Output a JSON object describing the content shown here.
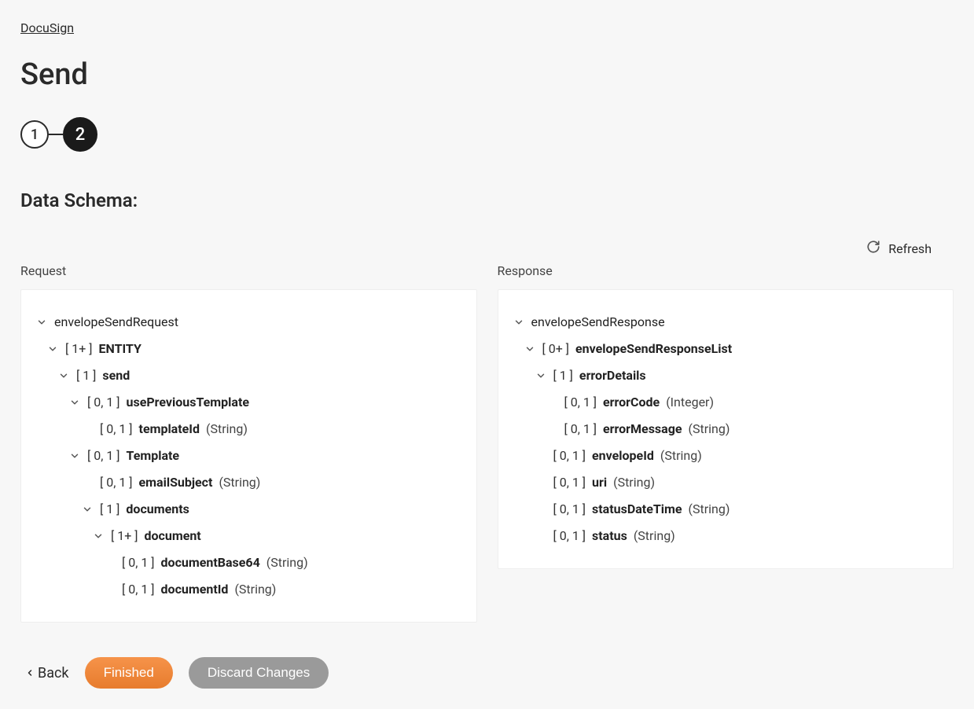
{
  "breadcrumb": "DocuSign",
  "page_title": "Send",
  "stepper": {
    "step1": "1",
    "step2": "2"
  },
  "section_title": "Data Schema:",
  "refresh_label": "Refresh",
  "request_label": "Request",
  "response_label": "Response",
  "request_tree": [
    {
      "indent": 0,
      "expandable": true,
      "cardinality": "",
      "name": "envelopeSendRequest",
      "bold": false,
      "type": ""
    },
    {
      "indent": 1,
      "expandable": true,
      "cardinality": "[ 1+ ]",
      "name": "ENTITY",
      "bold": true,
      "type": ""
    },
    {
      "indent": 2,
      "expandable": true,
      "cardinality": "[ 1 ]",
      "name": "send",
      "bold": true,
      "type": ""
    },
    {
      "indent": 3,
      "expandable": true,
      "cardinality": "[ 0, 1 ]",
      "name": "usePreviousTemplate",
      "bold": true,
      "type": ""
    },
    {
      "indent": 4,
      "expandable": false,
      "cardinality": "[ 0, 1 ]",
      "name": "templateId",
      "bold": true,
      "type": "(String)"
    },
    {
      "indent": 3,
      "expandable": true,
      "cardinality": "[ 0, 1 ]",
      "name": "Template",
      "bold": true,
      "type": ""
    },
    {
      "indent": 4,
      "expandable": false,
      "cardinality": "[ 0, 1 ]",
      "name": "emailSubject",
      "bold": true,
      "type": "(String)"
    },
    {
      "indent": 4,
      "expandable": true,
      "cardinality": "[ 1 ]",
      "name": "documents",
      "bold": true,
      "type": ""
    },
    {
      "indent": 5,
      "expandable": true,
      "cardinality": "[ 1+ ]",
      "name": "document",
      "bold": true,
      "type": ""
    },
    {
      "indent": 6,
      "expandable": false,
      "cardinality": "[ 0, 1 ]",
      "name": "documentBase64",
      "bold": true,
      "type": "(String)"
    },
    {
      "indent": 6,
      "expandable": false,
      "cardinality": "[ 0, 1 ]",
      "name": "documentId",
      "bold": true,
      "type": "(String)"
    }
  ],
  "response_tree": [
    {
      "indent": 0,
      "expandable": true,
      "cardinality": "",
      "name": "envelopeSendResponse",
      "bold": false,
      "type": ""
    },
    {
      "indent": 1,
      "expandable": true,
      "cardinality": "[ 0+ ]",
      "name": "envelopeSendResponseList",
      "bold": true,
      "type": ""
    },
    {
      "indent": 2,
      "expandable": true,
      "cardinality": "[ 1 ]",
      "name": "errorDetails",
      "bold": true,
      "type": ""
    },
    {
      "indent": 3,
      "expandable": false,
      "cardinality": "[ 0, 1 ]",
      "name": "errorCode",
      "bold": true,
      "type": "(Integer)"
    },
    {
      "indent": 3,
      "expandable": false,
      "cardinality": "[ 0, 1 ]",
      "name": "errorMessage",
      "bold": true,
      "type": "(String)"
    },
    {
      "indent": 2,
      "expandable": false,
      "cardinality": "[ 0, 1 ]",
      "name": "envelopeId",
      "bold": true,
      "type": "(String)"
    },
    {
      "indent": 2,
      "expandable": false,
      "cardinality": "[ 0, 1 ]",
      "name": "uri",
      "bold": true,
      "type": "(String)"
    },
    {
      "indent": 2,
      "expandable": false,
      "cardinality": "[ 0, 1 ]",
      "name": "statusDateTime",
      "bold": true,
      "type": "(String)"
    },
    {
      "indent": 2,
      "expandable": false,
      "cardinality": "[ 0, 1 ]",
      "name": "status",
      "bold": true,
      "type": "(String)"
    }
  ],
  "footer": {
    "back": "Back",
    "finished": "Finished",
    "discard": "Discard Changes"
  }
}
